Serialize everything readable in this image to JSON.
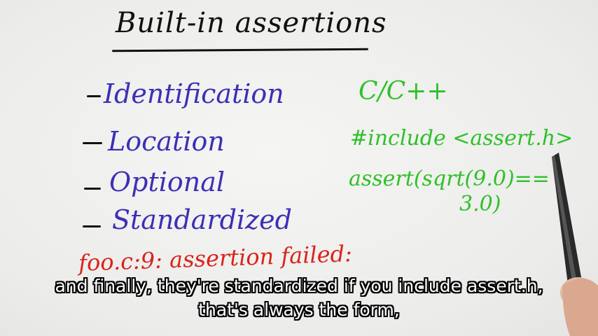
{
  "whiteboard": {
    "title": "Built-in assertions",
    "items": [
      {
        "label": "Identification"
      },
      {
        "label": "Location"
      },
      {
        "label": "Optional"
      },
      {
        "label": "Standardized"
      }
    ],
    "language": "C/C++",
    "include_line": "#include <assert.h>",
    "assert_line1": "assert(sqrt(9.0)==",
    "assert_line2": "3.0)",
    "error_line": "foo.c:9: assertion failed:",
    "colors": {
      "title": "#111111",
      "items": "#3c2fb6",
      "code": "#2fc02a",
      "error": "#d9231c"
    }
  },
  "captions": {
    "line1": "and finally, they're standardized if you include assert.h,",
    "line2": "that's always the form,"
  }
}
